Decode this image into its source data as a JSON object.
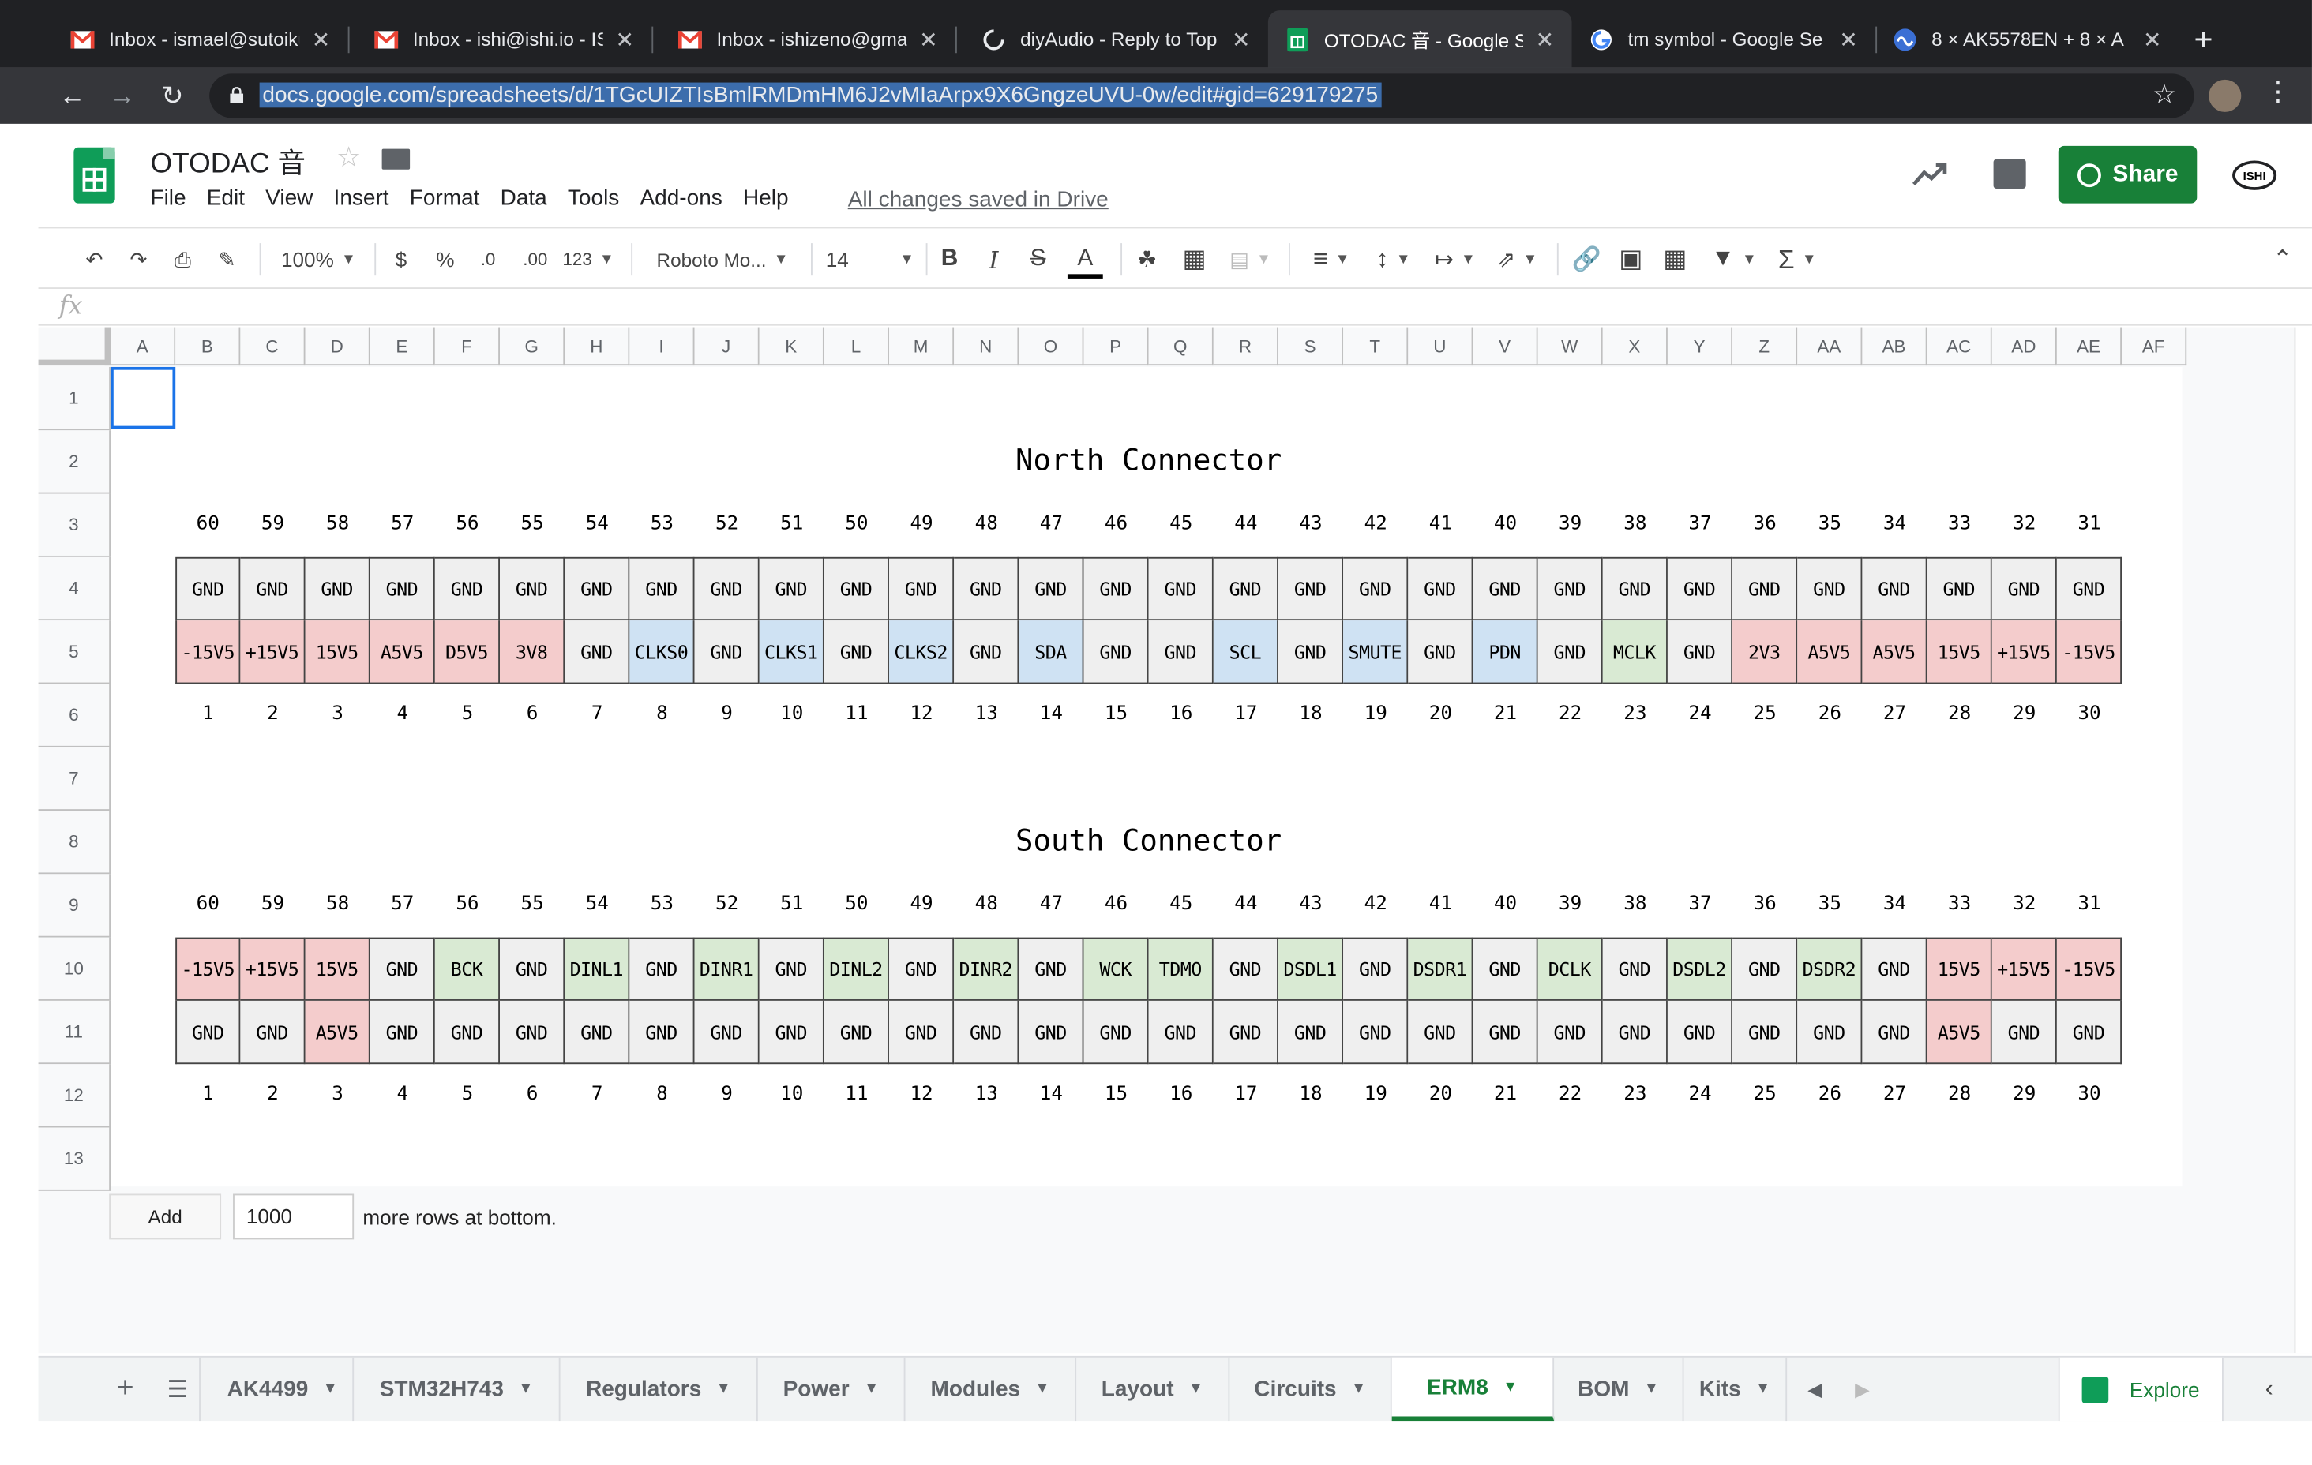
{
  "browser": {
    "tabs": [
      {
        "label": "Inbox - ismael@sutoiku",
        "icon": "gmail-icon"
      },
      {
        "label": "Inbox - ishi@ishi.io - IS",
        "icon": "gmail-icon"
      },
      {
        "label": "Inbox - ishizeno@gmail",
        "icon": "gmail-icon"
      },
      {
        "label": "diyAudio - Reply to Top",
        "icon": "loading-icon"
      },
      {
        "label": "OTODAC 音 - Google S",
        "icon": "sheets-icon",
        "active": true
      },
      {
        "label": "tm symbol - Google Se",
        "icon": "google-icon"
      },
      {
        "label": "8 × AK5578EN + 8 × A",
        "icon": "site-icon"
      }
    ],
    "url": "docs.google.com/spreadsheets/d/1TGcUIZTIsBmlRMDmHM6J2vMIaArpx9X6GngzeUVU-0w/edit#gid=629179275"
  },
  "doc": {
    "title": "OTODAC 音",
    "menus": [
      "File",
      "Edit",
      "View",
      "Insert",
      "Format",
      "Data",
      "Tools",
      "Add-ons",
      "Help"
    ],
    "saved_status": "All changes saved in Drive",
    "share_label": "Share",
    "avatar_text": "ISHI"
  },
  "toolbar": {
    "zoom": "100%",
    "currency": "$",
    "percent": "%",
    "dec_decrease": ".0",
    "dec_increase": ".00",
    "more_formats": "123",
    "font": "Roboto Mo...",
    "font_size": "14"
  },
  "formula_bar": {
    "label": "fx"
  },
  "grid": {
    "columns": [
      "A",
      "B",
      "C",
      "D",
      "E",
      "F",
      "G",
      "H",
      "I",
      "J",
      "K",
      "L",
      "M",
      "N",
      "O",
      "P",
      "Q",
      "R",
      "S",
      "T",
      "U",
      "V",
      "W",
      "X",
      "Y",
      "Z",
      "AA",
      "AB",
      "AC",
      "AD",
      "AE",
      "AF"
    ],
    "rows": [
      "1",
      "2",
      "3",
      "4",
      "5",
      "6",
      "7",
      "8",
      "9",
      "10",
      "11",
      "12",
      "13"
    ]
  },
  "colors": {
    "red": "#f4cccc",
    "blue": "#cfe2f3",
    "green": "#d9ead3",
    "gray": "#efefef"
  },
  "north": {
    "title": "North Connector",
    "top_pins": [
      "60",
      "59",
      "58",
      "57",
      "56",
      "55",
      "54",
      "53",
      "52",
      "51",
      "50",
      "49",
      "48",
      "47",
      "46",
      "45",
      "44",
      "43",
      "42",
      "41",
      "40",
      "39",
      "38",
      "37",
      "36",
      "35",
      "34",
      "33",
      "32",
      "31"
    ],
    "row1": [
      {
        "t": "GND",
        "c": "gray"
      },
      {
        "t": "GND",
        "c": "gray"
      },
      {
        "t": "GND",
        "c": "gray"
      },
      {
        "t": "GND",
        "c": "gray"
      },
      {
        "t": "GND",
        "c": "gray"
      },
      {
        "t": "GND",
        "c": "gray"
      },
      {
        "t": "GND",
        "c": "gray"
      },
      {
        "t": "GND",
        "c": "gray"
      },
      {
        "t": "GND",
        "c": "gray"
      },
      {
        "t": "GND",
        "c": "gray"
      },
      {
        "t": "GND",
        "c": "gray"
      },
      {
        "t": "GND",
        "c": "gray"
      },
      {
        "t": "GND",
        "c": "gray"
      },
      {
        "t": "GND",
        "c": "gray"
      },
      {
        "t": "GND",
        "c": "gray"
      },
      {
        "t": "GND",
        "c": "gray"
      },
      {
        "t": "GND",
        "c": "gray"
      },
      {
        "t": "GND",
        "c": "gray"
      },
      {
        "t": "GND",
        "c": "gray"
      },
      {
        "t": "GND",
        "c": "gray"
      },
      {
        "t": "GND",
        "c": "gray"
      },
      {
        "t": "GND",
        "c": "gray"
      },
      {
        "t": "GND",
        "c": "gray"
      },
      {
        "t": "GND",
        "c": "gray"
      },
      {
        "t": "GND",
        "c": "gray"
      },
      {
        "t": "GND",
        "c": "gray"
      },
      {
        "t": "GND",
        "c": "gray"
      },
      {
        "t": "GND",
        "c": "gray"
      },
      {
        "t": "GND",
        "c": "gray"
      },
      {
        "t": "GND",
        "c": "gray"
      }
    ],
    "row2": [
      {
        "t": "-15V5",
        "c": "red"
      },
      {
        "t": "+15V5",
        "c": "red"
      },
      {
        "t": "15V5",
        "c": "red"
      },
      {
        "t": "A5V5",
        "c": "red"
      },
      {
        "t": "D5V5",
        "c": "red"
      },
      {
        "t": "3V8",
        "c": "red"
      },
      {
        "t": "GND",
        "c": "gray"
      },
      {
        "t": "CLKS0",
        "c": "blue"
      },
      {
        "t": "GND",
        "c": "gray"
      },
      {
        "t": "CLKS1",
        "c": "blue"
      },
      {
        "t": "GND",
        "c": "gray"
      },
      {
        "t": "CLKS2",
        "c": "blue"
      },
      {
        "t": "GND",
        "c": "gray"
      },
      {
        "t": "SDA",
        "c": "blue"
      },
      {
        "t": "GND",
        "c": "gray"
      },
      {
        "t": "GND",
        "c": "gray"
      },
      {
        "t": "SCL",
        "c": "blue"
      },
      {
        "t": "GND",
        "c": "gray"
      },
      {
        "t": "SMUTE",
        "c": "blue"
      },
      {
        "t": "GND",
        "c": "gray"
      },
      {
        "t": "PDN",
        "c": "blue"
      },
      {
        "t": "GND",
        "c": "gray"
      },
      {
        "t": "MCLK",
        "c": "green"
      },
      {
        "t": "GND",
        "c": "gray"
      },
      {
        "t": "2V3",
        "c": "red"
      },
      {
        "t": "A5V5",
        "c": "red"
      },
      {
        "t": "A5V5",
        "c": "red"
      },
      {
        "t": "15V5",
        "c": "red"
      },
      {
        "t": "+15V5",
        "c": "red"
      },
      {
        "t": "-15V5",
        "c": "red"
      }
    ],
    "bottom_pins": [
      "1",
      "2",
      "3",
      "4",
      "5",
      "6",
      "7",
      "8",
      "9",
      "10",
      "11",
      "12",
      "13",
      "14",
      "15",
      "16",
      "17",
      "18",
      "19",
      "20",
      "21",
      "22",
      "23",
      "24",
      "25",
      "26",
      "27",
      "28",
      "29",
      "30"
    ]
  },
  "south": {
    "title": "South Connector",
    "top_pins": [
      "60",
      "59",
      "58",
      "57",
      "56",
      "55",
      "54",
      "53",
      "52",
      "51",
      "50",
      "49",
      "48",
      "47",
      "46",
      "45",
      "44",
      "43",
      "42",
      "41",
      "40",
      "39",
      "38",
      "37",
      "36",
      "35",
      "34",
      "33",
      "32",
      "31"
    ],
    "row1": [
      {
        "t": "-15V5",
        "c": "red"
      },
      {
        "t": "+15V5",
        "c": "red"
      },
      {
        "t": "15V5",
        "c": "red"
      },
      {
        "t": "GND",
        "c": "gray"
      },
      {
        "t": "BCK",
        "c": "green"
      },
      {
        "t": "GND",
        "c": "gray"
      },
      {
        "t": "DINL1",
        "c": "green"
      },
      {
        "t": "GND",
        "c": "gray"
      },
      {
        "t": "DINR1",
        "c": "green"
      },
      {
        "t": "GND",
        "c": "gray"
      },
      {
        "t": "DINL2",
        "c": "green"
      },
      {
        "t": "GND",
        "c": "gray"
      },
      {
        "t": "DINR2",
        "c": "green"
      },
      {
        "t": "GND",
        "c": "gray"
      },
      {
        "t": "WCK",
        "c": "green"
      },
      {
        "t": "TDMO",
        "c": "green"
      },
      {
        "t": "GND",
        "c": "gray"
      },
      {
        "t": "DSDL1",
        "c": "green"
      },
      {
        "t": "GND",
        "c": "gray"
      },
      {
        "t": "DSDR1",
        "c": "green"
      },
      {
        "t": "GND",
        "c": "gray"
      },
      {
        "t": "DCLK",
        "c": "green"
      },
      {
        "t": "GND",
        "c": "gray"
      },
      {
        "t": "DSDL2",
        "c": "green"
      },
      {
        "t": "GND",
        "c": "gray"
      },
      {
        "t": "DSDR2",
        "c": "green"
      },
      {
        "t": "GND",
        "c": "gray"
      },
      {
        "t": "15V5",
        "c": "red"
      },
      {
        "t": "+15V5",
        "c": "red"
      },
      {
        "t": "-15V5",
        "c": "red"
      }
    ],
    "row2": [
      {
        "t": "GND",
        "c": "gray"
      },
      {
        "t": "GND",
        "c": "gray"
      },
      {
        "t": "A5V5",
        "c": "red"
      },
      {
        "t": "GND",
        "c": "gray"
      },
      {
        "t": "GND",
        "c": "gray"
      },
      {
        "t": "GND",
        "c": "gray"
      },
      {
        "t": "GND",
        "c": "gray"
      },
      {
        "t": "GND",
        "c": "gray"
      },
      {
        "t": "GND",
        "c": "gray"
      },
      {
        "t": "GND",
        "c": "gray"
      },
      {
        "t": "GND",
        "c": "gray"
      },
      {
        "t": "GND",
        "c": "gray"
      },
      {
        "t": "GND",
        "c": "gray"
      },
      {
        "t": "GND",
        "c": "gray"
      },
      {
        "t": "GND",
        "c": "gray"
      },
      {
        "t": "GND",
        "c": "gray"
      },
      {
        "t": "GND",
        "c": "gray"
      },
      {
        "t": "GND",
        "c": "gray"
      },
      {
        "t": "GND",
        "c": "gray"
      },
      {
        "t": "GND",
        "c": "gray"
      },
      {
        "t": "GND",
        "c": "gray"
      },
      {
        "t": "GND",
        "c": "gray"
      },
      {
        "t": "GND",
        "c": "gray"
      },
      {
        "t": "GND",
        "c": "gray"
      },
      {
        "t": "GND",
        "c": "gray"
      },
      {
        "t": "GND",
        "c": "gray"
      },
      {
        "t": "GND",
        "c": "gray"
      },
      {
        "t": "A5V5",
        "c": "red"
      },
      {
        "t": "GND",
        "c": "gray"
      },
      {
        "t": "GND",
        "c": "gray"
      }
    ],
    "bottom_pins": [
      "1",
      "2",
      "3",
      "4",
      "5",
      "6",
      "7",
      "8",
      "9",
      "10",
      "11",
      "12",
      "13",
      "14",
      "15",
      "16",
      "17",
      "18",
      "19",
      "20",
      "21",
      "22",
      "23",
      "24",
      "25",
      "26",
      "27",
      "28",
      "29",
      "30"
    ]
  },
  "add_rows": {
    "button": "Add",
    "value": "1000",
    "text": "more rows at bottom."
  },
  "sheet_tabs": [
    {
      "label": "AK4499"
    },
    {
      "label": "STM32H743"
    },
    {
      "label": "Regulators"
    },
    {
      "label": "Power"
    },
    {
      "label": "Modules"
    },
    {
      "label": "Layout"
    },
    {
      "label": "Circuits"
    },
    {
      "label": "ERM8",
      "active": true
    },
    {
      "label": "BOM"
    },
    {
      "label": "Kits"
    }
  ],
  "explore_label": "Explore"
}
